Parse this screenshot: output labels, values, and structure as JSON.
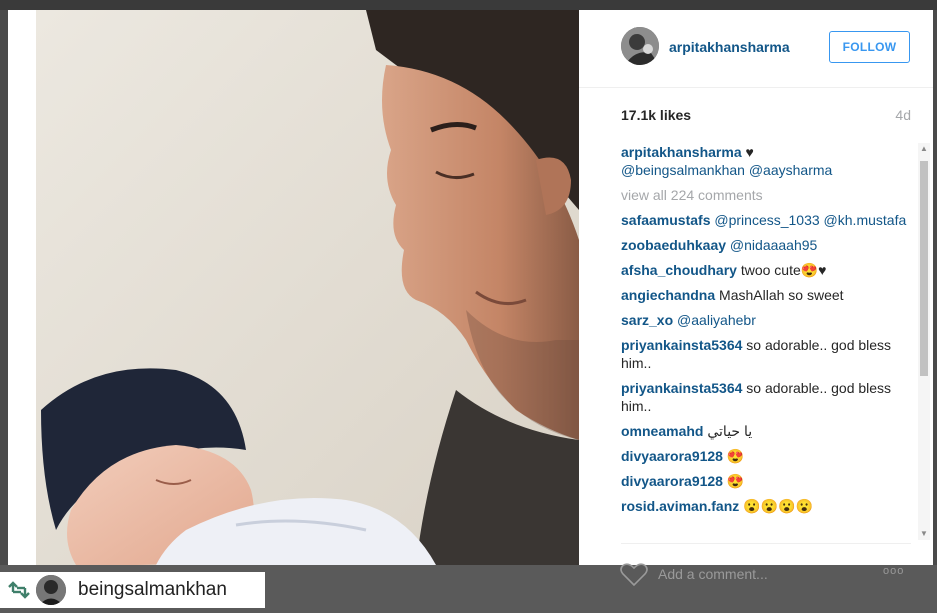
{
  "post": {
    "username": "arpitakhansharma",
    "follow_label": "FOLLOW",
    "likes": "17.1k likes",
    "time_ago": "4d"
  },
  "caption": {
    "user": "arpitakhansharma",
    "heart": "♥",
    "mentions": "@beingsalmankhan @aaysharma"
  },
  "view_all": "view all 224 comments",
  "comments": [
    {
      "user": "safaamustafs",
      "text": "@princess_1033 @kh.mustafa",
      "mention": true
    },
    {
      "user": "zoobaeduhkaay",
      "text": "@nidaaaah95",
      "mention": true
    },
    {
      "user": "afsha_choudhary",
      "text": "twoo cute😍♥",
      "mention": false
    },
    {
      "user": "angiechandna",
      "text": "MashAllah so sweet",
      "mention": false
    },
    {
      "user": "sarz_xo",
      "text": "@aaliyahebr",
      "mention": true
    },
    {
      "user": "priyankainsta5364",
      "text": "so adorable.. god bless him..",
      "mention": false
    },
    {
      "user": "priyankainsta5364",
      "text": "so adorable.. god bless him..",
      "mention": false
    },
    {
      "user": "omneamahd",
      "text": "يا حياتي",
      "mention": false
    },
    {
      "user": "divyaarora9128",
      "text": "😍",
      "mention": false
    },
    {
      "user": "divyaarora9128",
      "text": "😍",
      "mention": false
    },
    {
      "user": "rosid.aviman.fanz",
      "text": "😮😮😮😮",
      "mention": false
    }
  ],
  "add_comment_placeholder": "Add a comment...",
  "more_glyph": "ooo",
  "repost": {
    "username": "beingsalmankhan"
  },
  "icons": {
    "heart": "heart-icon",
    "more": "more-options-icon",
    "repost": "repost-icon",
    "scroll_up": "scroll-up-arrow-icon",
    "scroll_down": "scroll-down-arrow-icon"
  },
  "colors": {
    "username_blue": "#125688",
    "follow_blue": "#3897f0",
    "muted_gray": "#a5a7aa"
  }
}
